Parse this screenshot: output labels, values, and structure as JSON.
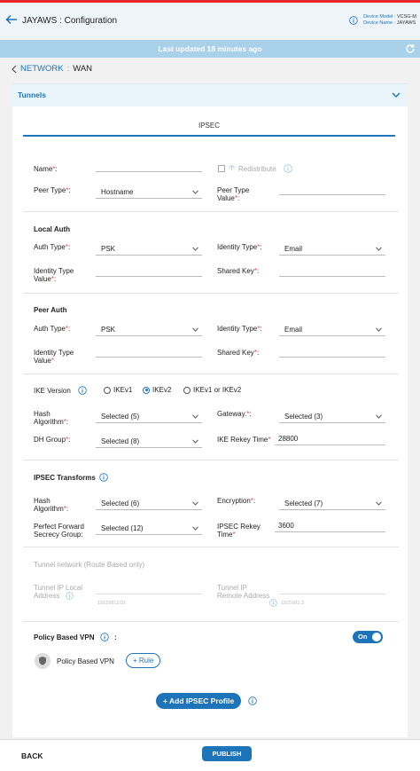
{
  "header": {
    "title": "JAYAWS : Configuration",
    "device_model_label": "Device Model :",
    "device_model_value": "VCSG-M",
    "device_name_label": "Device Name :",
    "device_name_value": "JAYAWS"
  },
  "status": {
    "updated": "Last updated 18 minutes ago"
  },
  "breadcrumb": {
    "network": "NETWORK",
    "separator": ":",
    "section": "WAN"
  },
  "tunnels": {
    "label": "Tunnels",
    "tab": "IPSEC"
  },
  "form": {
    "name_label": "Name",
    "redistribute_label": "Redistribute",
    "peer_type_label": "Peer Type",
    "peer_type_value": "Hostname",
    "peer_type_value_label_1": "Peer Type",
    "peer_type_value_label_2": "Value",
    "local_auth": {
      "title": "Local Auth",
      "auth_type_label": "Auth Type",
      "auth_type_value": "PSK",
      "identity_type_label": "Identity Type",
      "identity_type_value": "Email",
      "identity_value_label_1": "Identity Type",
      "identity_value_label_2": "Value",
      "shared_key_label": "Shared Key"
    },
    "peer_auth": {
      "title": "Peer Auth",
      "auth_type_label": "Auth Type",
      "auth_type_value": "PSK",
      "identity_type_label": "Identity Type",
      "identity_type_value": "Email",
      "identity_value_label_1": "Identity Type",
      "identity_value_label_2": "Value",
      "shared_key_label": "Shared Key"
    },
    "ike": {
      "version_label": "IKE Version",
      "options": [
        "IKEv1",
        "IKEv2",
        "IKEv1 or IKEv2"
      ],
      "selected": "IKEv2",
      "hash_label_1": "Hash",
      "hash_label_2": "Algorithm",
      "hash_value": "Selected (5)",
      "gateway_label": "Gateway.",
      "gateway_value": "Selected (3)",
      "dh_label": "DH Group",
      "dh_value": "Selected (8)",
      "rekey_label": "IKE Rekey Time",
      "rekey_value": "28800"
    },
    "ipsec": {
      "title": "IPSEC Transforms",
      "hash_label_1": "Hash",
      "hash_label_2": "Algorithm",
      "hash_value": "Selected (6)",
      "encryption_label": "Encryption",
      "encryption_value": "Selected (7)",
      "pfs_label_1": "Perfect Forward",
      "pfs_label_2": "Secrecy Group:",
      "pfs_value": "Selected (12)",
      "rekey_label_1": "IPSEC Rekey",
      "rekey_label_2": "Time",
      "rekey_value": "3600"
    },
    "tunnel_network": {
      "title": "Tunnel network (Route Based only)",
      "local_label_1": "Tunnel IP Local",
      "local_label_2": "Address",
      "local_hint": "19216812/31",
      "remote_label_1": "Tunnel IP",
      "remote_label_2": "Remote Address",
      "remote_hint": "1921681.3"
    },
    "policy": {
      "title": "Policy Based VPN",
      "colon": ":",
      "toggle": "On",
      "item_label": "Policy Based VPN",
      "rule_button": "+ Rule"
    },
    "add_button": "+ Add IPSEC Profile"
  },
  "footer": {
    "back": "BACK",
    "publish": "PUBLISH"
  },
  "colors": {
    "accent": "#1d74b8",
    "topline": "#e8262b",
    "banner": "#a9d2ea"
  }
}
